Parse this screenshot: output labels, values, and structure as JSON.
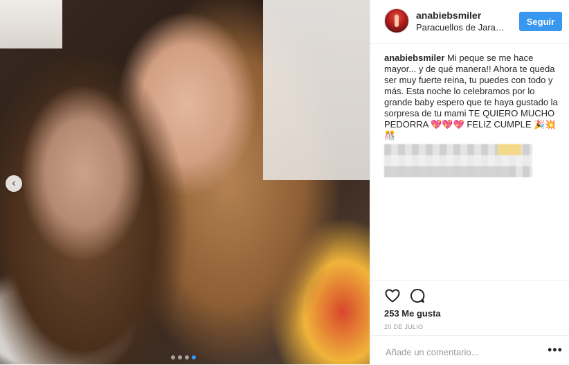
{
  "post": {
    "username": "anabiebsmiler",
    "location": "Paracuellos de Jara…",
    "follow_label": "Seguir",
    "caption_user": "anabiebsmiler",
    "caption_text": " Mi peque se me hace mayor... y de qué manera!! Ahora te queda ser muy fuerte reina, tu puedes con todo y más. Esta noche lo celebramos por lo grande baby espero que te haya gustado la sorpresa de tu mami TE QUIERO MUCHO PEDORRA 💖💖💖 FELIZ CUMPLE 🎉💥🎊",
    "likes": "253 Me gusta",
    "date": "20 DE JULIO",
    "comment_placeholder": "Añade un comentario...",
    "more_label": "•••",
    "carousel_prev": "‹",
    "carousel_total": 4,
    "carousel_active": 4
  },
  "icons": {
    "like": "heart-icon",
    "comment": "comment-icon",
    "avatar": "profile-avatar"
  },
  "colors": {
    "accent": "#3897f0",
    "text": "#262626",
    "muted": "#999999",
    "border": "#efefef"
  }
}
